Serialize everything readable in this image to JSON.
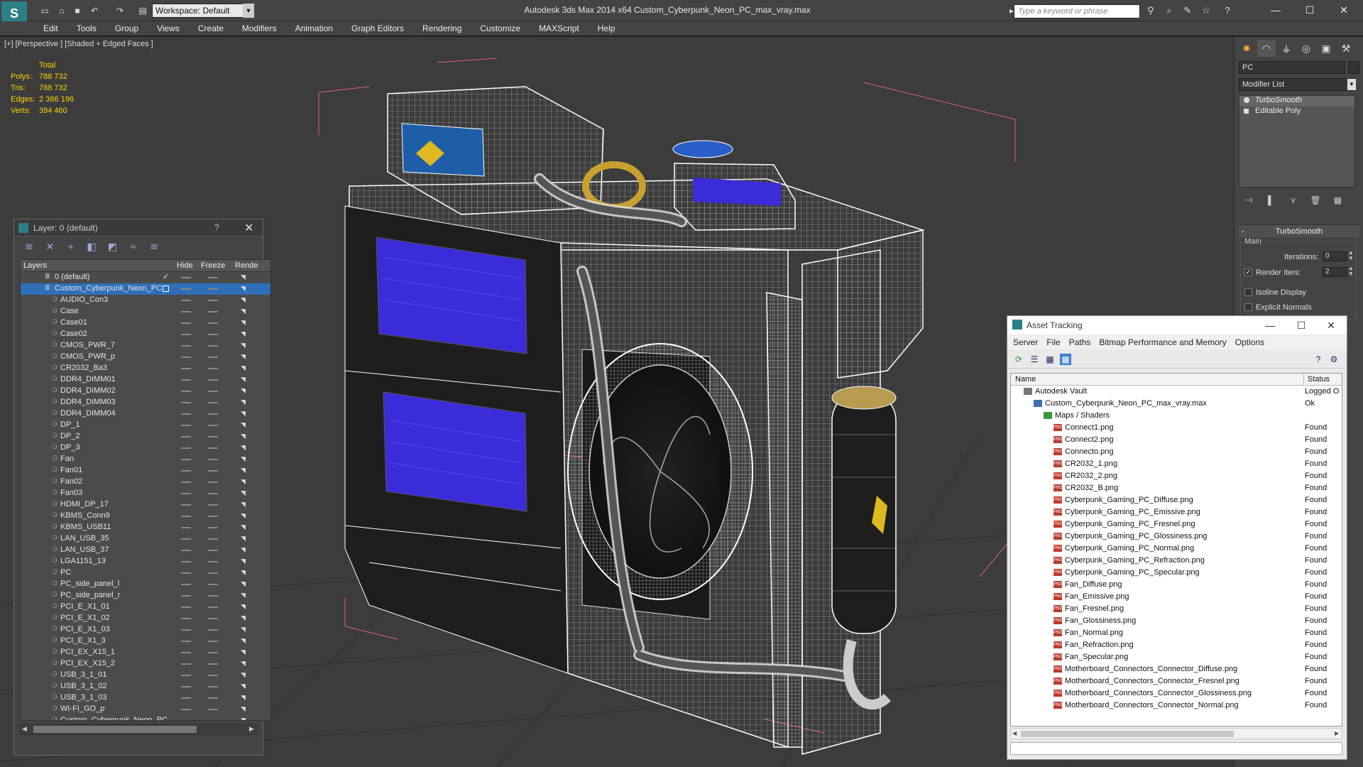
{
  "titlebar": {
    "logo_text": "S",
    "workspace": "Workspace: Default",
    "title": "Autodesk 3ds Max  2014 x64      Custom_Cyberpunk_Neon_PC_max_vray.max",
    "search_placeholder": "Type a keyword or phrase"
  },
  "menu": [
    "Edit",
    "Tools",
    "Group",
    "Views",
    "Create",
    "Modifiers",
    "Animation",
    "Graph Editors",
    "Rendering",
    "Customize",
    "MAXScript",
    "Help"
  ],
  "viewport": {
    "label": "[+] [Perspective ] [Shaded + Edged Faces ]",
    "stats_header": "Total",
    "stats": [
      {
        "label": "Polys:",
        "value": "788 732"
      },
      {
        "label": "Tris:",
        "value": "788 732"
      },
      {
        "label": "Edges:",
        "value": "2 366 196"
      },
      {
        "label": "Verts:",
        "value": "394 460"
      }
    ]
  },
  "layer_panel": {
    "title": "Layer: 0 (default)",
    "help": "?",
    "columns": {
      "layers": "Layers",
      "hide": "Hide",
      "freeze": "Freeze",
      "render": "Rende"
    },
    "rows": [
      {
        "name": "0 (default)",
        "level": 0
      },
      {
        "name": "Custom_Cyberpunk_Neon_PC",
        "level": 0,
        "selected": true
      },
      {
        "name": "AUDIO_Con3",
        "level": 1
      },
      {
        "name": "Case",
        "level": 1
      },
      {
        "name": "Case01",
        "level": 1
      },
      {
        "name": "Case02",
        "level": 1
      },
      {
        "name": "CMOS_PWR_7",
        "level": 1
      },
      {
        "name": "CMOS_PWR_p",
        "level": 1
      },
      {
        "name": "CR2032_Ba3",
        "level": 1
      },
      {
        "name": "DDR4_DIMM01",
        "level": 1
      },
      {
        "name": "DDR4_DIMM02",
        "level": 1
      },
      {
        "name": "DDR4_DIMM03",
        "level": 1
      },
      {
        "name": "DDR4_DIMM04",
        "level": 1
      },
      {
        "name": "DP_1",
        "level": 1
      },
      {
        "name": "DP_2",
        "level": 1
      },
      {
        "name": "DP_3",
        "level": 1
      },
      {
        "name": "Fan",
        "level": 1
      },
      {
        "name": "Fan01",
        "level": 1
      },
      {
        "name": "Fan02",
        "level": 1
      },
      {
        "name": "Fan03",
        "level": 1
      },
      {
        "name": "HDMI_DP_17",
        "level": 1
      },
      {
        "name": "KBMS_Conn9",
        "level": 1
      },
      {
        "name": "KBMS_USB11",
        "level": 1
      },
      {
        "name": "LAN_USB_35",
        "level": 1
      },
      {
        "name": "LAN_USB_37",
        "level": 1
      },
      {
        "name": "LGA1151_13",
        "level": 1
      },
      {
        "name": "PC",
        "level": 1
      },
      {
        "name": "PC_side_panel_l",
        "level": 1
      },
      {
        "name": "PC_side_panel_r",
        "level": 1
      },
      {
        "name": "PCI_E_X1_01",
        "level": 1
      },
      {
        "name": "PCI_E_X1_02",
        "level": 1
      },
      {
        "name": "PCI_E_X1_03",
        "level": 1
      },
      {
        "name": "PCI_E_X1_3",
        "level": 1
      },
      {
        "name": "PCI_EX_X15_1",
        "level": 1
      },
      {
        "name": "PCI_EX_X15_2",
        "level": 1
      },
      {
        "name": "USB_3_1_01",
        "level": 1
      },
      {
        "name": "USB_3_1_02",
        "level": 1
      },
      {
        "name": "USB_3_1_03",
        "level": 1
      },
      {
        "name": "WI-FI_GO_p",
        "level": 1
      },
      {
        "name": "Custom_Cyberpunk_Neon_PC",
        "level": 1
      }
    ]
  },
  "command_panel": {
    "object_name": "PC",
    "modifier_list": "Modifier List",
    "stack": [
      {
        "name": "TurboSmooth",
        "active": true
      },
      {
        "name": "Editable Poly",
        "active": false
      }
    ],
    "rollout_title": "TurboSmooth",
    "group_main": "Main",
    "iterations_label": "Iterations:",
    "iterations_value": "0",
    "render_iters_label": "Render Iters:",
    "render_iters_value": "2",
    "isoline_label": "Isoline Display",
    "explicit_label": "Explicit Normals"
  },
  "asset_tracking": {
    "title": "Asset Tracking",
    "menu": [
      "Server",
      "File",
      "Paths",
      "Bitmap Performance and Memory",
      "Options"
    ],
    "columns": {
      "name": "Name",
      "status": "Status"
    },
    "rows": [
      {
        "name": "Autodesk Vault",
        "status": "Logged O",
        "indent": 0,
        "kind": "vault"
      },
      {
        "name": "Custom_Cyberpunk_Neon_PC_max_vray.max",
        "status": "Ok",
        "indent": 1,
        "kind": "max"
      },
      {
        "name": "Maps / Shaders",
        "status": "",
        "indent": 2,
        "kind": "folder"
      },
      {
        "name": "Connect1.png",
        "status": "Found",
        "indent": 3,
        "kind": "png"
      },
      {
        "name": "Connect2.png",
        "status": "Found",
        "indent": 3,
        "kind": "png"
      },
      {
        "name": "Connecto.png",
        "status": "Found",
        "indent": 3,
        "kind": "png"
      },
      {
        "name": "CR2032_1.png",
        "status": "Found",
        "indent": 3,
        "kind": "png"
      },
      {
        "name": "CR2032_2.png",
        "status": "Found",
        "indent": 3,
        "kind": "png"
      },
      {
        "name": "CR2032_B.png",
        "status": "Found",
        "indent": 3,
        "kind": "png"
      },
      {
        "name": "Cyberpunk_Gaming_PC_Diffuse.png",
        "status": "Found",
        "indent": 3,
        "kind": "png"
      },
      {
        "name": "Cyberpunk_Gaming_PC_Emissive.png",
        "status": "Found",
        "indent": 3,
        "kind": "png"
      },
      {
        "name": "Cyberpunk_Gaming_PC_Fresnel.png",
        "status": "Found",
        "indent": 3,
        "kind": "png"
      },
      {
        "name": "Cyberpunk_Gaming_PC_Glossiness.png",
        "status": "Found",
        "indent": 3,
        "kind": "png"
      },
      {
        "name": "Cyberpunk_Gaming_PC_Normal.png",
        "status": "Found",
        "indent": 3,
        "kind": "png"
      },
      {
        "name": "Cyberpunk_Gaming_PC_Refraction.png",
        "status": "Found",
        "indent": 3,
        "kind": "png"
      },
      {
        "name": "Cyberpunk_Gaming_PC_Specular.png",
        "status": "Found",
        "indent": 3,
        "kind": "png"
      },
      {
        "name": "Fan_Diffuse.png",
        "status": "Found",
        "indent": 3,
        "kind": "png"
      },
      {
        "name": "Fan_Emissive.png",
        "status": "Found",
        "indent": 3,
        "kind": "png"
      },
      {
        "name": "Fan_Fresnel.png",
        "status": "Found",
        "indent": 3,
        "kind": "png"
      },
      {
        "name": "Fan_Glossiness.png",
        "status": "Found",
        "indent": 3,
        "kind": "png"
      },
      {
        "name": "Fan_Normal.png",
        "status": "Found",
        "indent": 3,
        "kind": "png"
      },
      {
        "name": "Fan_Refraction.png",
        "status": "Found",
        "indent": 3,
        "kind": "png"
      },
      {
        "name": "Fan_Specular.png",
        "status": "Found",
        "indent": 3,
        "kind": "png"
      },
      {
        "name": "Motherboard_Connectors_Connector_Diffuse.png",
        "status": "Found",
        "indent": 3,
        "kind": "png"
      },
      {
        "name": "Motherboard_Connectors_Connector_Fresnel.png",
        "status": "Found",
        "indent": 3,
        "kind": "png"
      },
      {
        "name": "Motherboard_Connectors_Connector_Glossiness.png",
        "status": "Found",
        "indent": 3,
        "kind": "png"
      },
      {
        "name": "Motherboard_Connectors_Connector_Normal.png",
        "status": "Found",
        "indent": 3,
        "kind": "png"
      }
    ]
  },
  "colors": {
    "accent": "#2f6fb8",
    "stats": "#ffd400",
    "wire": "#ffffff",
    "panel_glow": "#4a3cff",
    "bbox": "#e0607c"
  },
  "icons": [
    "app-logo-icon",
    "new-icon",
    "open-icon",
    "save-icon",
    "undo-icon",
    "redo-icon",
    "search-icon",
    "star-icon",
    "help-icon",
    "close-icon",
    "minimize-icon",
    "maximize-icon"
  ]
}
